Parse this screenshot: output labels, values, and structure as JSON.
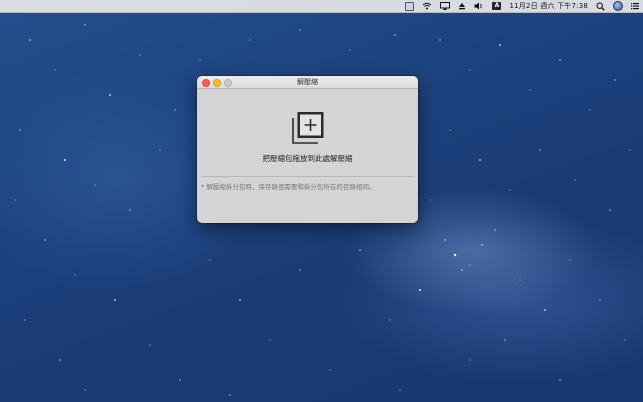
{
  "menubar": {
    "icons": [
      "input-source-icon",
      "wifi-icon",
      "airplay-icon",
      "eject-icon",
      "volume-icon",
      "text-input-icon",
      "spotlight-search-icon",
      "user-avatar-icon",
      "notification-list-icon"
    ],
    "text_input_badge": "A",
    "clock": "11月2日 週六 下午7:38"
  },
  "window": {
    "title": "解壓縮",
    "drop_label": "把壓縮包拖放到此處解壓縮",
    "note": "* 解壓縮拆分包時，保存路徑需要和拆分包所在的目錄相同。",
    "traffic_colors": {
      "close": "#fc5f57",
      "minimize": "#fdbc2e",
      "zoom": "#c9c9c9"
    }
  },
  "colors": {
    "desktop_bg": "#1d437f",
    "window_bg": "#d4d4d4"
  }
}
